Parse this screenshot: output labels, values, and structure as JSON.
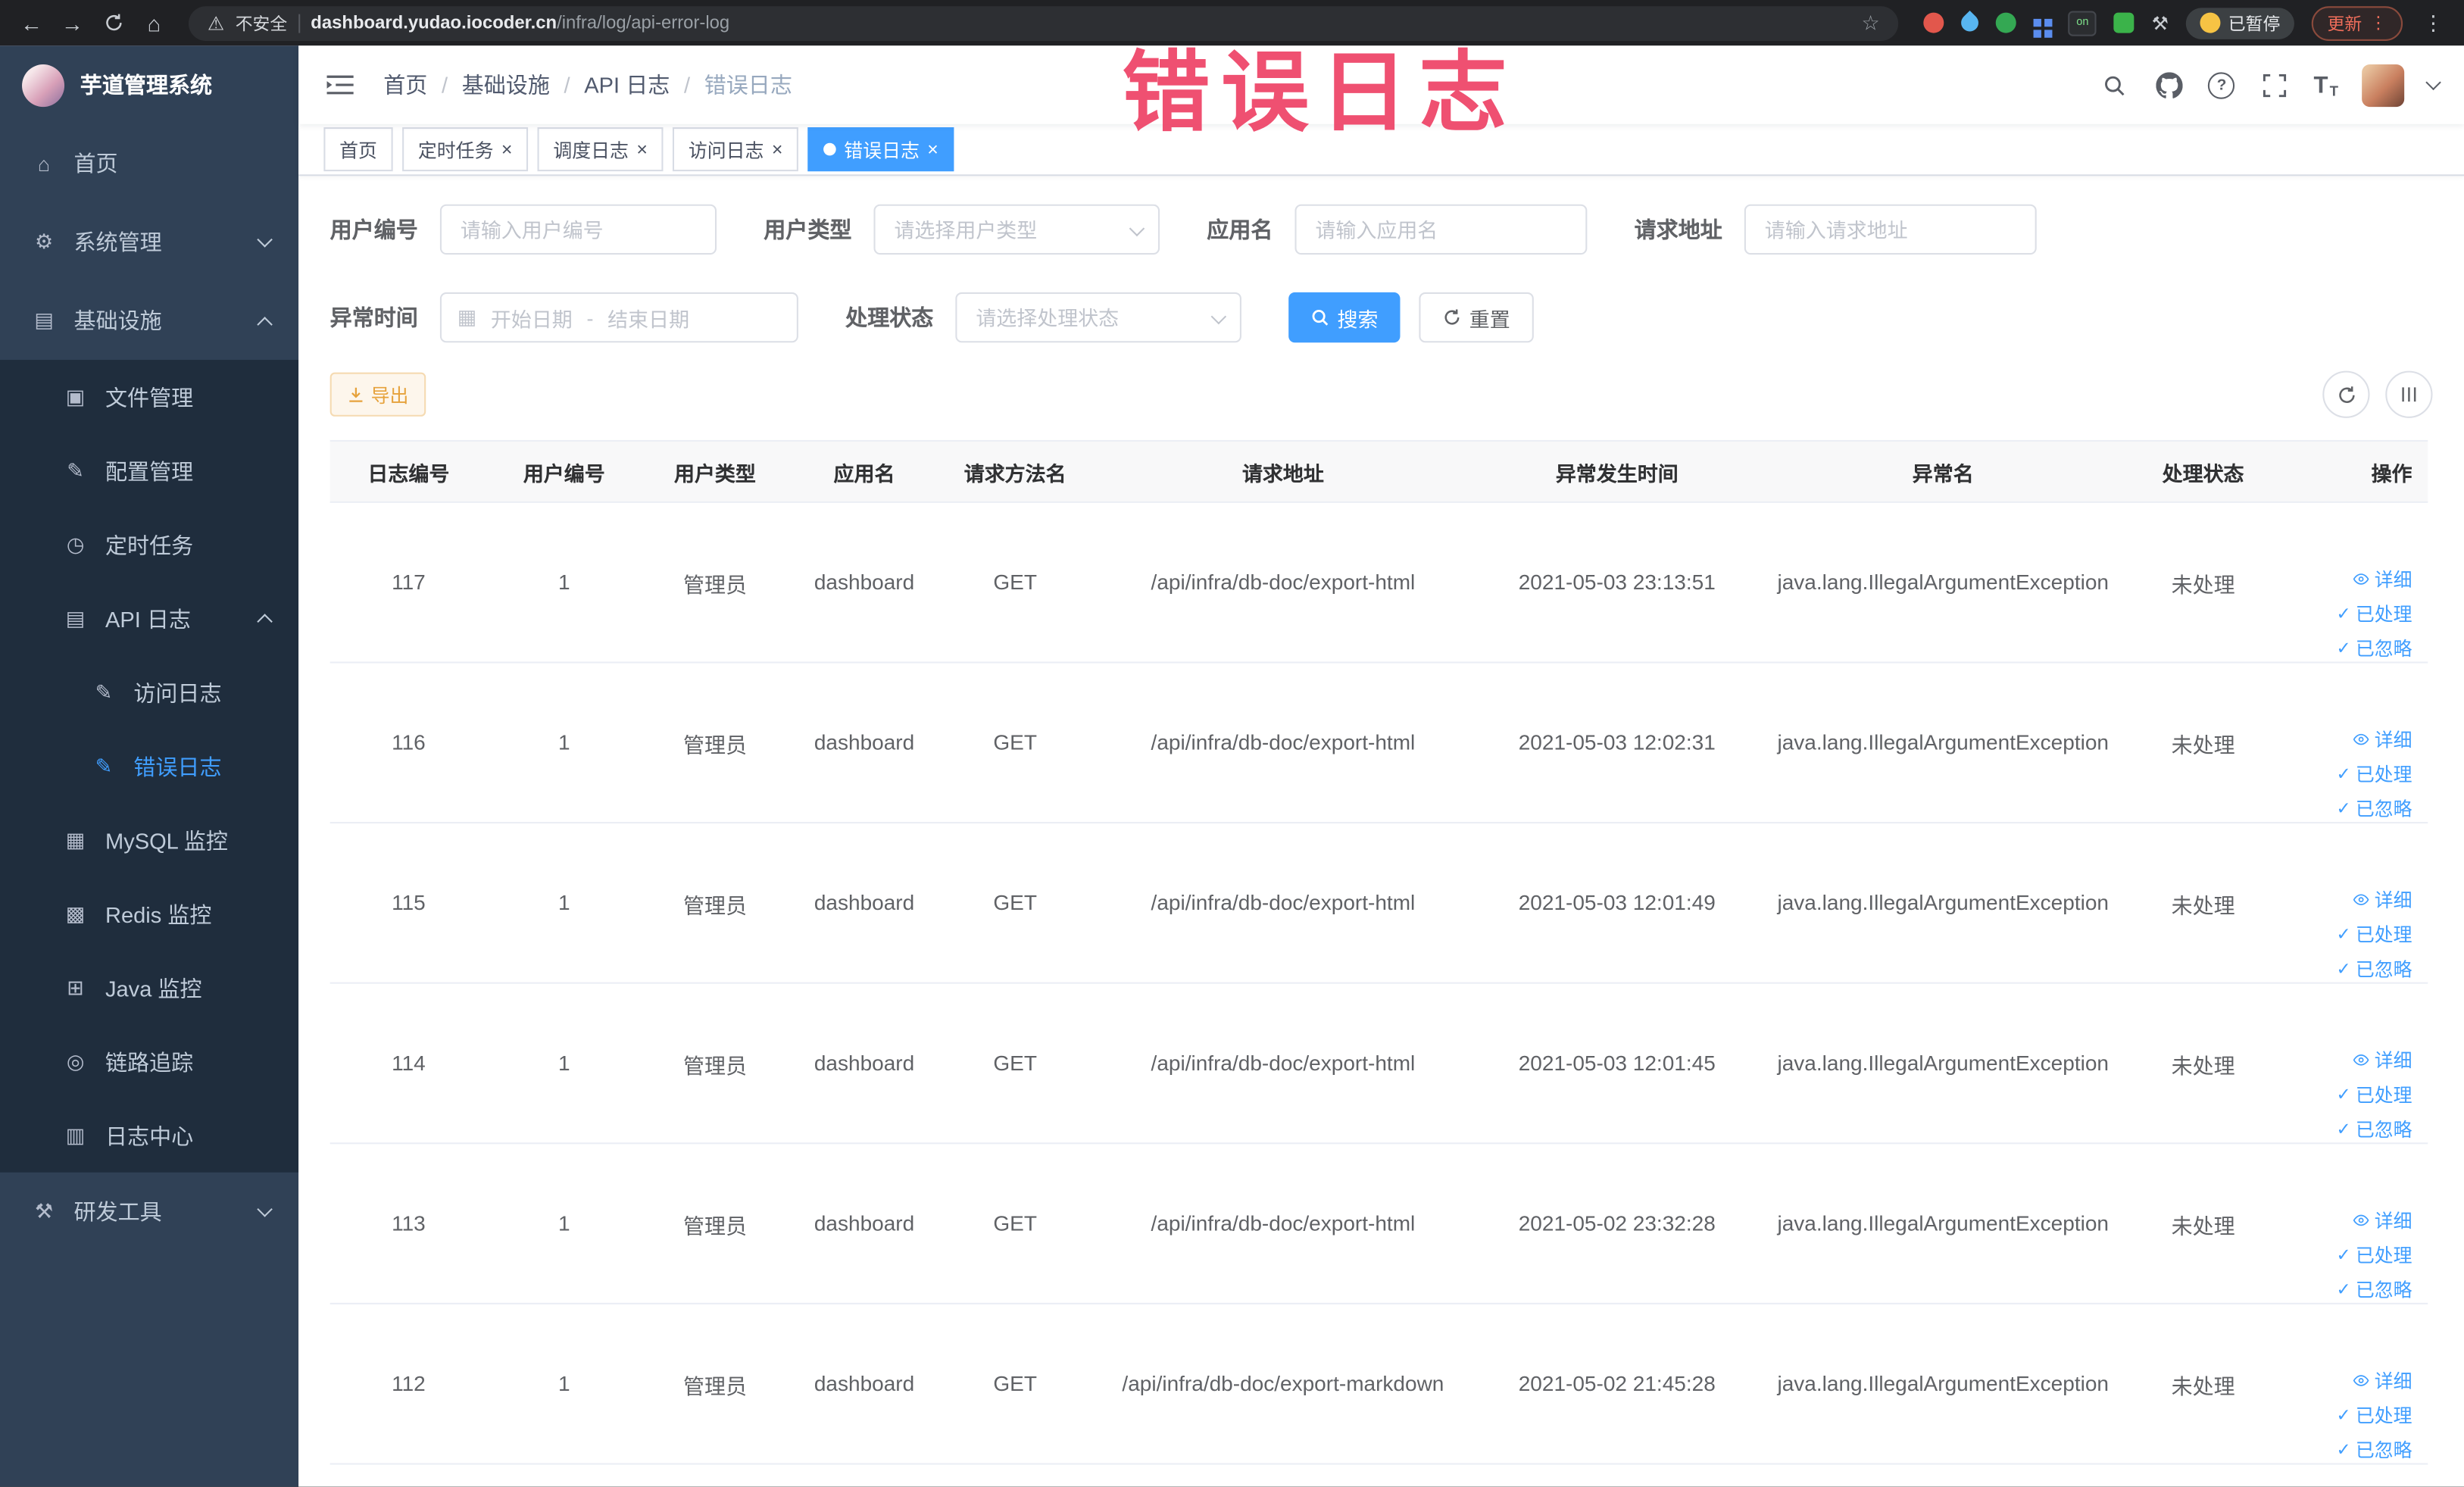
{
  "browser": {
    "security_label": "不安全",
    "url_domain": "dashboard.yudao.iocoder.cn",
    "url_path": "/infra/log/api-error-log",
    "paused_chip": "已暂停",
    "update_chip": "更新",
    "on_badge": "on"
  },
  "annotation": {
    "text": "错误日志"
  },
  "icons": {
    "back": "←",
    "forward": "→",
    "home": "⌂",
    "warning": "⚠",
    "star": "☆",
    "dots": "⋮",
    "close": "×",
    "check": "✓",
    "question": "?",
    "t_large": "T",
    "t_small": "T",
    "menu_home": "⌂",
    "menu_system": "⚙",
    "menu_infra": "▤",
    "menu_file": "▣",
    "menu_config": "✎",
    "menu_job": "◷",
    "menu_api_log": "▤",
    "menu_access": "✎",
    "menu_error": "✎",
    "menu_mysql": "▦",
    "menu_redis": "▩",
    "menu_java": "⊞",
    "menu_trace": "◎",
    "menu_log_center": "▥",
    "menu_tools": "⚒",
    "calendar": "▦"
  },
  "sidebar": {
    "logo_title": "芋道管理系统",
    "items": {
      "home": "首页",
      "system": "系统管理",
      "infra": "基础设施",
      "file": "文件管理",
      "config": "配置管理",
      "job": "定时任务",
      "api_log": "API 日志",
      "access_log": "访问日志",
      "error_log": "错误日志",
      "mysql": "MySQL 监控",
      "redis": "Redis 监控",
      "java": "Java 监控",
      "trace": "链路追踪",
      "log_center": "日志中心",
      "dev_tools": "研发工具"
    }
  },
  "breadcrumb": {
    "items": [
      "首页",
      "基础设施",
      "API 日志",
      "错误日志"
    ]
  },
  "tags": {
    "t0": "首页",
    "t1": "定时任务",
    "t2": "调度日志",
    "t3": "访问日志",
    "t4": "错误日志"
  },
  "filters": {
    "user_id_label": "用户编号",
    "user_id_placeholder": "请输入用户编号",
    "user_type_label": "用户类型",
    "user_type_placeholder": "请选择用户类型",
    "app_name_label": "应用名",
    "app_name_placeholder": "请输入应用名",
    "request_url_label": "请求地址",
    "request_url_placeholder": "请输入请求地址",
    "time_label": "异常时间",
    "time_start_placeholder": "开始日期",
    "time_separator": "-",
    "time_end_placeholder": "结束日期",
    "status_label": "处理状态",
    "status_placeholder": "请选择处理状态",
    "search_label": "搜索",
    "reset_label": "重置"
  },
  "toolbar": {
    "export_label": "导出"
  },
  "table": {
    "columns": [
      "日志编号",
      "用户编号",
      "用户类型",
      "应用名",
      "请求方法名",
      "请求地址",
      "异常发生时间",
      "异常名",
      "处理状态",
      "操作"
    ],
    "actions": {
      "detail": "详细",
      "process": "已处理",
      "ignore": "已忽略"
    },
    "rows": [
      {
        "id": "117",
        "user_id": "1",
        "user_type": "管理员",
        "app_name": "dashboard",
        "method": "GET",
        "url": "/api/infra/db-doc/export-html",
        "time": "2021-05-03 23:13:51",
        "exception": "java.lang.IllegalArgumentException",
        "status": "未处理"
      },
      {
        "id": "116",
        "user_id": "1",
        "user_type": "管理员",
        "app_name": "dashboard",
        "method": "GET",
        "url": "/api/infra/db-doc/export-html",
        "time": "2021-05-03 12:02:31",
        "exception": "java.lang.IllegalArgumentException",
        "status": "未处理"
      },
      {
        "id": "115",
        "user_id": "1",
        "user_type": "管理员",
        "app_name": "dashboard",
        "method": "GET",
        "url": "/api/infra/db-doc/export-html",
        "time": "2021-05-03 12:01:49",
        "exception": "java.lang.IllegalArgumentException",
        "status": "未处理"
      },
      {
        "id": "114",
        "user_id": "1",
        "user_type": "管理员",
        "app_name": "dashboard",
        "method": "GET",
        "url": "/api/infra/db-doc/export-html",
        "time": "2021-05-03 12:01:45",
        "exception": "java.lang.IllegalArgumentException",
        "status": "未处理"
      },
      {
        "id": "113",
        "user_id": "1",
        "user_type": "管理员",
        "app_name": "dashboard",
        "method": "GET",
        "url": "/api/infra/db-doc/export-html",
        "time": "2021-05-02 23:32:28",
        "exception": "java.lang.IllegalArgumentException",
        "status": "未处理"
      },
      {
        "id": "112",
        "user_id": "1",
        "user_type": "管理员",
        "app_name": "dashboard",
        "method": "GET",
        "url": "/api/infra/db-doc/export-markdown",
        "time": "2021-05-02 21:45:28",
        "exception": "java.lang.IllegalArgumentException",
        "status": "未处理"
      }
    ]
  }
}
